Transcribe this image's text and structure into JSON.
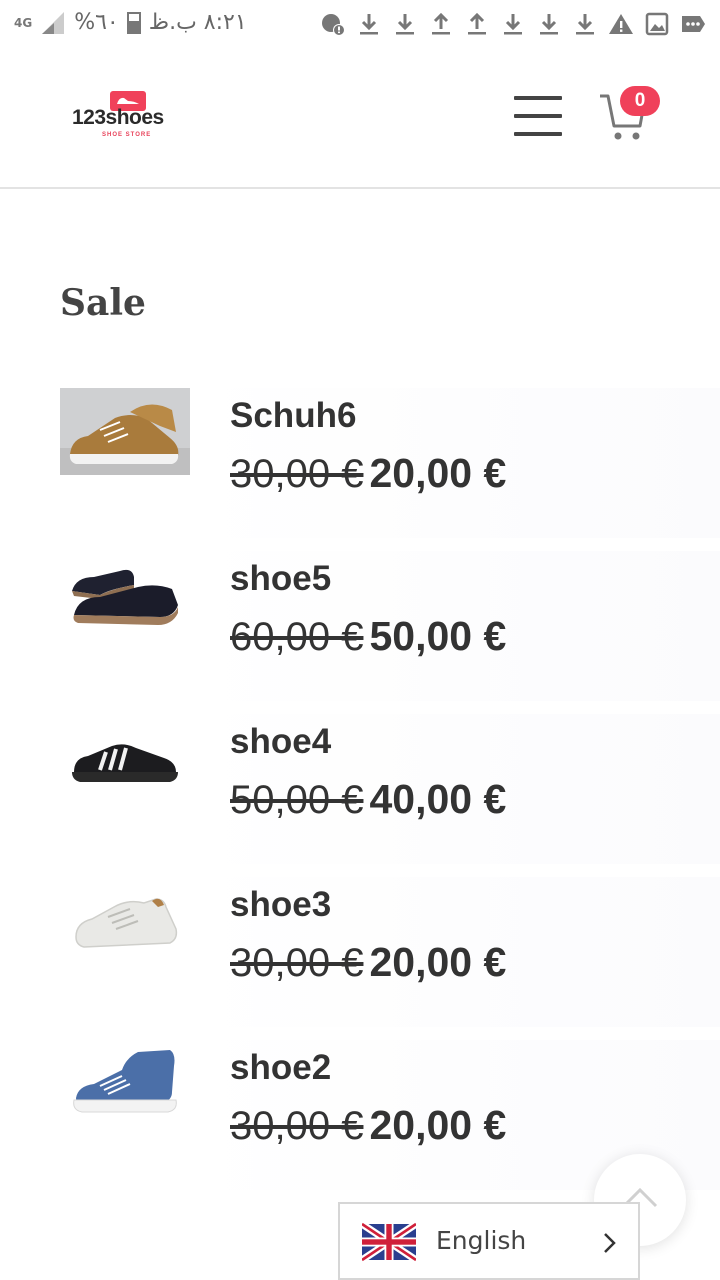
{
  "status_bar": {
    "time": "٨:٢١ ب.ظ",
    "battery": "٦٠%",
    "network": "4G",
    "icons": [
      "chat-alert-icon",
      "download-icon",
      "download-icon",
      "upload-icon",
      "upload-icon",
      "download-icon",
      "download-icon",
      "download-icon",
      "warning-icon",
      "image-icon",
      "more-icon"
    ]
  },
  "header": {
    "logo_text": "123shoes",
    "logo_sub": "SHOE STORE",
    "cart_count": "0",
    "accent_color": "#f0415a"
  },
  "section": {
    "title": "Sale"
  },
  "products": [
    {
      "name": "Schuh6",
      "old_price": "30,00 €",
      "new_price": "20,00 €",
      "image": "brown-sneaker"
    },
    {
      "name": "shoe5",
      "old_price": "60,00 €",
      "new_price": "50,00 €",
      "image": "black-slip-on"
    },
    {
      "name": "shoe4",
      "old_price": "50,00 €",
      "new_price": "40,00 €",
      "image": "black-striped-sneaker"
    },
    {
      "name": "shoe3",
      "old_price": "30,00 €",
      "new_price": "20,00 €",
      "image": "white-sneaker"
    },
    {
      "name": "shoe2",
      "old_price": "30,00 €",
      "new_price": "20,00 €",
      "image": "blue-high-top"
    }
  ],
  "language_switcher": {
    "label": "English",
    "flag": "uk-flag-icon"
  }
}
